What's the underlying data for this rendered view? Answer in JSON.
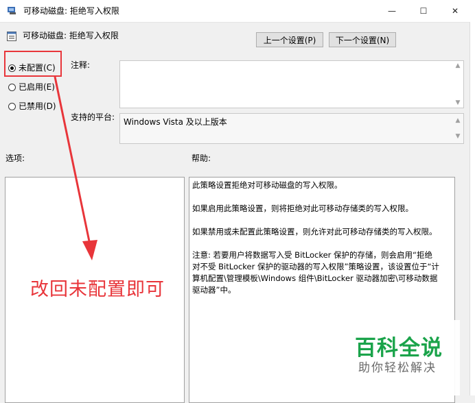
{
  "window": {
    "title": "可移动磁盘: 拒绝写入权限",
    "minimize_glyph": "—",
    "maximize_glyph": "☐",
    "close_glyph": "✕"
  },
  "header": {
    "policy_name": "可移动磁盘: 拒绝写入权限",
    "prev_button": "上一个设置(P)",
    "next_button": "下一个设置(N)"
  },
  "radios": [
    {
      "label": "未配置(C)",
      "selected": true
    },
    {
      "label": "已启用(E)",
      "selected": false
    },
    {
      "label": "已禁用(D)",
      "selected": false
    }
  ],
  "fields": {
    "comment_label": "注释:",
    "comment_value": "",
    "platform_label": "支持的平台:",
    "platform_value": "Windows Vista 及以上版本"
  },
  "sections": {
    "options_label": "选项:",
    "help_label": "帮助:"
  },
  "help_text": [
    "此策略设置拒绝对可移动磁盘的写入权限。",
    "如果启用此策略设置，则将拒绝对此可移动存储类的写入权限。",
    "如果禁用或未配置此策略设置，则允许对此可移动存储类的写入权限。",
    "注意: 若要用户将数据写入受 BitLocker 保护的存储，则会启用“拒绝对不受 BitLocker 保护的驱动器的写入权限”策略设置，该设置位于“计算机配置\\管理模板\\Windows 组件\\BitLocker 驱动器加密\\可移动数据驱动器”中。"
  ],
  "annotation": {
    "text": "改回未配置即可",
    "color": "#e8353a"
  },
  "watermark": {
    "brand": "百科全说",
    "slogan": "助你轻松解决",
    "color": "#1aa34a"
  }
}
